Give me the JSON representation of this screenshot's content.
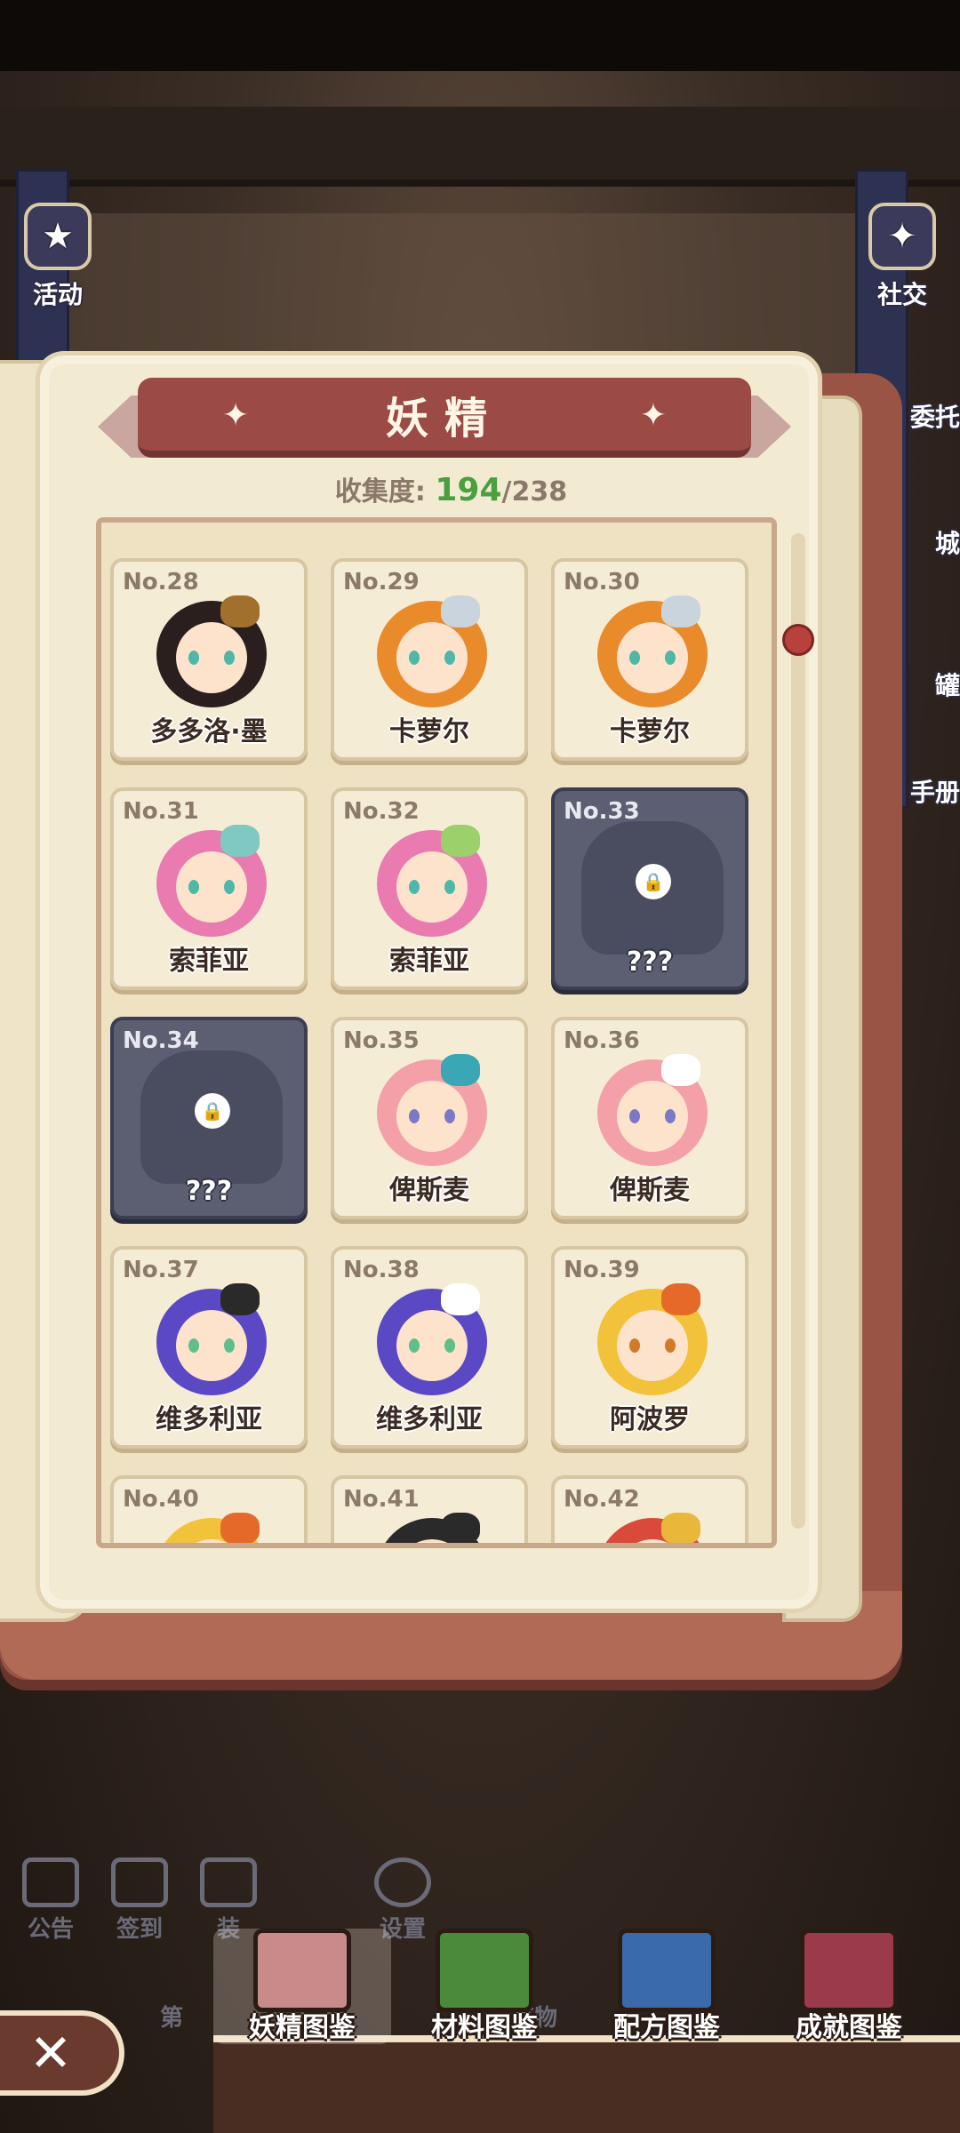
{
  "top_left": {
    "label": "活动"
  },
  "top_right": {
    "labels": [
      "社交",
      "委托",
      "城",
      "罐",
      "手册"
    ]
  },
  "book": {
    "title": "妖精",
    "collection_label": "收集度:",
    "collection_current": "194",
    "collection_total": "/238"
  },
  "cards": [
    {
      "no": "No.28",
      "name": "多多洛·墨",
      "locked": false,
      "hair": "#2a1e1e",
      "eye": "#4fb7a8",
      "accent": "#a0702c"
    },
    {
      "no": "No.29",
      "name": "卡萝尔",
      "locked": false,
      "hair": "#e98b2a",
      "eye": "#4fb7a8",
      "accent": "#c9d4dc"
    },
    {
      "no": "No.30",
      "name": "卡萝尔",
      "locked": false,
      "hair": "#e98b2a",
      "eye": "#4fb7a8",
      "accent": "#c9d4dc"
    },
    {
      "no": "No.31",
      "name": "索菲亚",
      "locked": false,
      "hair": "#e97bb1",
      "eye": "#4fb7a8",
      "accent": "#7fc9c2"
    },
    {
      "no": "No.32",
      "name": "索菲亚",
      "locked": false,
      "hair": "#e97bb1",
      "eye": "#4fb7a8",
      "accent": "#9bd06a"
    },
    {
      "no": "No.33",
      "name": "???",
      "locked": true
    },
    {
      "no": "No.34",
      "name": "???",
      "locked": true
    },
    {
      "no": "No.35",
      "name": "俾斯麦",
      "locked": false,
      "hair": "#f4a0a8",
      "eye": "#7c79c4",
      "accent": "#3aa7b5"
    },
    {
      "no": "No.36",
      "name": "俾斯麦",
      "locked": false,
      "hair": "#f4a0a8",
      "eye": "#7c79c4",
      "accent": "#ffffff"
    },
    {
      "no": "No.37",
      "name": "维多利亚",
      "locked": false,
      "hair": "#5a48c4",
      "eye": "#5fbf8a",
      "accent": "#2a2a2a"
    },
    {
      "no": "No.38",
      "name": "维多利亚",
      "locked": false,
      "hair": "#5a48c4",
      "eye": "#5fbf8a",
      "accent": "#ffffff"
    },
    {
      "no": "No.39",
      "name": "阿波罗",
      "locked": false,
      "hair": "#f2c23a",
      "eye": "#d07a2a",
      "accent": "#e56a2a"
    },
    {
      "no": "No.40",
      "name": "",
      "locked": false,
      "hair": "#f2c23a",
      "eye": "#d07a2a",
      "accent": "#e56a2a"
    },
    {
      "no": "No.41",
      "name": "",
      "locked": false,
      "hair": "#2a2a2a",
      "eye": "#555555",
      "accent": "#2a2a2a"
    },
    {
      "no": "No.42",
      "name": "",
      "locked": false,
      "hair": "#d94a3a",
      "eye": "#555555",
      "accent": "#e9b73a"
    }
  ],
  "bottom_icons": [
    {
      "label": "公告"
    },
    {
      "label": "签到"
    },
    {
      "label": "装"
    },
    {
      "label": "设置"
    }
  ],
  "tabs": [
    {
      "label": "妖精图鉴",
      "color": "#c98a8a",
      "active": true
    },
    {
      "label": "材料图鉴",
      "color": "#4a8a3a",
      "active": false
    },
    {
      "label": "配方图鉴",
      "color": "#3a6aaa",
      "active": false
    },
    {
      "label": "成就图鉴",
      "color": "#9a3a4a",
      "active": false
    }
  ],
  "partial_bottom_labels": [
    "第",
    "育物"
  ],
  "close_label": "✕",
  "icons": [
    "lock-icon",
    "close-icon",
    "star-icon"
  ]
}
